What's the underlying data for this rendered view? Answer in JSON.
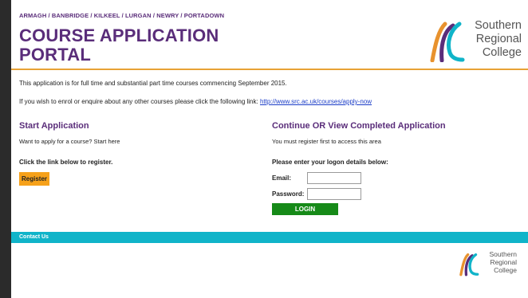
{
  "header": {
    "towns": "ARMAGH / BANBRIDGE / KILKEEL / LURGAN / NEWRY / PORTADOWN",
    "title_line1": "COURSE APPLICATION",
    "title_line2": "PORTAL",
    "logo": {
      "line1": "Southern",
      "line2": "Regional",
      "line3": "College"
    }
  },
  "intro": {
    "line1": "This application is for full time and substantial part time courses commencing September 2015.",
    "line2_text": "If you wish to enrol or enquire about any other courses please click the following link: ",
    "line2_link": "http://www.src.ac.uk/courses/apply-now"
  },
  "start": {
    "title": "Start Application",
    "subtitle": "Want to apply for a course? Start here",
    "label": "Click the link below to register.",
    "register_label": "Register"
  },
  "continue": {
    "title": "Continue OR View Completed Application",
    "subtitle": "You must register first to access this area",
    "label": "Please enter your logon details below:",
    "email_label": "Email:",
    "email_value": "",
    "password_label": "Password:",
    "password_value": "",
    "login_label": "LOGIN"
  },
  "footer": {
    "contact_label": "Contact Us",
    "logo": {
      "line1": "Southern",
      "line2": "Regional",
      "line3": "College"
    }
  },
  "colors": {
    "brand_purple": "#5a2d7a",
    "accent_orange": "#e8a235",
    "register_orange": "#f6a11a",
    "login_green": "#168a18",
    "footer_teal": "#10b4c9",
    "link_blue": "#1a3cc7"
  }
}
